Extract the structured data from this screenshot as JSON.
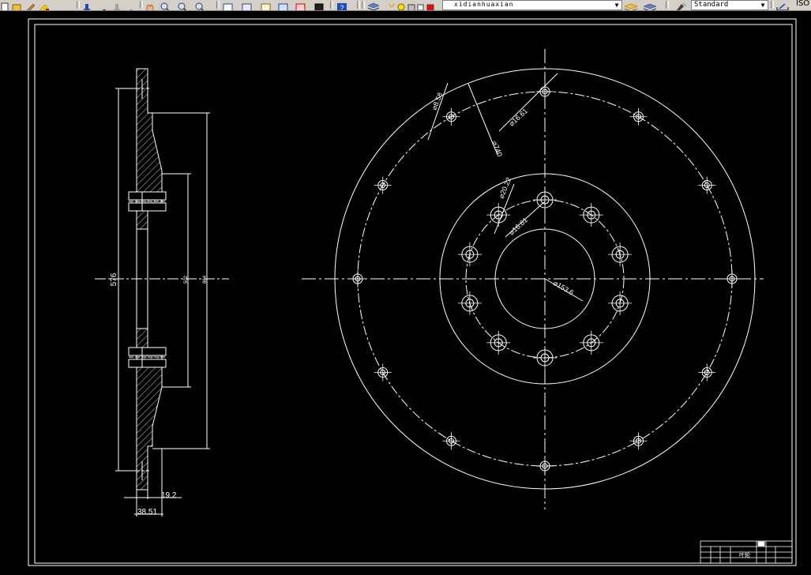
{
  "toolbar": {
    "layer_name": "xidianhuaxian",
    "text_style": "Standard",
    "dim_style_partial": "ISO",
    "icons": [
      "new-icon",
      "open-icon",
      "edit-icon",
      "matchprop-icon",
      "undo-icon",
      "redo-icon",
      "pan-icon",
      "zoom-realtime-icon",
      "zoom-window-icon",
      "zoom-previous-icon",
      "properties-icon",
      "designcenter-icon",
      "toolpalette-icon",
      "sheetset-icon",
      "markup-icon",
      "calculator-icon",
      "help-icon",
      "layer-manager-icon",
      "layer-state-icons",
      "layer-color-icon",
      "make-object-layer-current-icon",
      "layer-previous-icon",
      "text-style-icon",
      "dim-style-icon"
    ]
  },
  "drawing": {
    "side_view": {
      "dim_total_height": "576",
      "dim_inner_1": "502",
      "dim_inner_2": "864",
      "dim_thickness_1": "19.2",
      "dim_thickness_2": "38.51"
    },
    "front_view": {
      "dim_small_hole": "⌀8.58",
      "dim_pcd_outer_hole": "⌀16.61",
      "dim_outer_circle": "⌀740",
      "dim_mid_hole": "⌀20.22",
      "dim_pcd_mid_hole": "⌀16.61",
      "dim_bore": "⌀153.6"
    },
    "title_block": {
      "part_name": "叶轮"
    },
    "colors": {
      "background": "#000000",
      "lines": "#ffffff",
      "layer_swatch": "#ff0000"
    }
  }
}
